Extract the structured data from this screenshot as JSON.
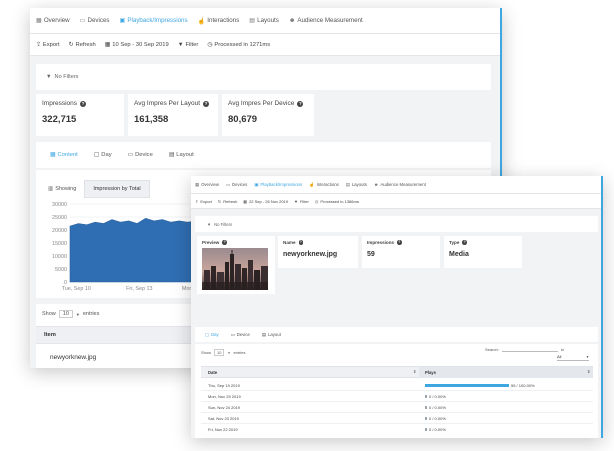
{
  "nav": [
    {
      "label": "Overview",
      "icon": "dashboard-icon",
      "active": false
    },
    {
      "label": "Devices",
      "icon": "monitor-icon",
      "active": false
    },
    {
      "label": "Playback/Impressions",
      "icon": "play-icon",
      "active": true
    },
    {
      "label": "Interactions",
      "icon": "hand-icon",
      "active": false
    },
    {
      "label": "Layouts",
      "icon": "layout-icon",
      "active": false
    },
    {
      "label": "Audience Measurement",
      "icon": "people-icon",
      "active": false
    }
  ],
  "back": {
    "toolbar": {
      "export": "Export",
      "refresh": "Refresh",
      "date_range": "10 Sep - 30 Sep 2019",
      "filter": "Filter",
      "processed": "Processed in 1271ms"
    },
    "filters_text": "No Filters",
    "stats": [
      {
        "label": "Impressions",
        "value": "322,715"
      },
      {
        "label": "Avg Impres Per Layout",
        "value": "161,358"
      },
      {
        "label": "Avg Impres Per Device",
        "value": "80,679"
      }
    ],
    "tabs": [
      "Content",
      "Day",
      "Device",
      "Layout"
    ],
    "subtabs": [
      "Showing",
      "Impression by Total"
    ],
    "table": {
      "show_label": "Show",
      "entries_value": "10",
      "entries_label": "entries",
      "column_item": "Item",
      "row1": "newyorknew.jpg"
    }
  },
  "front": {
    "toolbar": {
      "export": "Export",
      "refresh": "Refresh",
      "date_range": "22 Sep - 26 Nov 2019",
      "filter": "Filter",
      "processed": "Processed in 1386ms"
    },
    "filters_text": "No Filters",
    "info": {
      "preview_label": "Preview",
      "name_label": "Name",
      "name_value": "newyorknew.jpg",
      "impressions_label": "Impressions",
      "impressions_value": "59",
      "type_label": "Type",
      "type_value": "Media"
    },
    "tabs": [
      "Day",
      "Device",
      "Layout"
    ],
    "table": {
      "show_label": "Show",
      "entries_value": "10",
      "entries_label": "entries",
      "search_label": "Search:",
      "in_label": "in",
      "select_value": "All",
      "col_date": "Date",
      "col_plays": "Plays",
      "rows": [
        {
          "date": "Thu, Sep 19 2019",
          "plays": "55 / 100.00%",
          "fraction": 1.0
        },
        {
          "date": "Mon, Nov 25 2019",
          "plays": "0 / 0.00%",
          "fraction": 0
        },
        {
          "date": "Sun, Nov 24 2019",
          "plays": "0 / 0.00%",
          "fraction": 0
        },
        {
          "date": "Sat, Nov 23 2019",
          "plays": "0 / 0.00%",
          "fraction": 0
        },
        {
          "date": "Fri, Nov 22 2019",
          "plays": "0 / 0.00%",
          "fraction": 0
        }
      ]
    }
  },
  "chart_data": {
    "type": "area",
    "x": [
      "Tue, Sep 10",
      "Fri, Sep 13",
      "Mon"
    ],
    "yticks": [
      "30000",
      "25000",
      "20000",
      "15000",
      "10000",
      "5000",
      "0"
    ],
    "ylim": [
      0,
      30000
    ],
    "series": [
      {
        "values": [
          21500,
          22500,
          22000,
          23000,
          22500,
          24000,
          23000,
          23500,
          22500,
          24500,
          23500,
          24000,
          23000,
          23500,
          23000,
          23500
        ]
      }
    ],
    "color": "#2f6eb2"
  },
  "colors": {
    "accent": "#3ea6e0",
    "area_fill": "#2f6eb2",
    "plays_bar": "#3ea6e0"
  }
}
